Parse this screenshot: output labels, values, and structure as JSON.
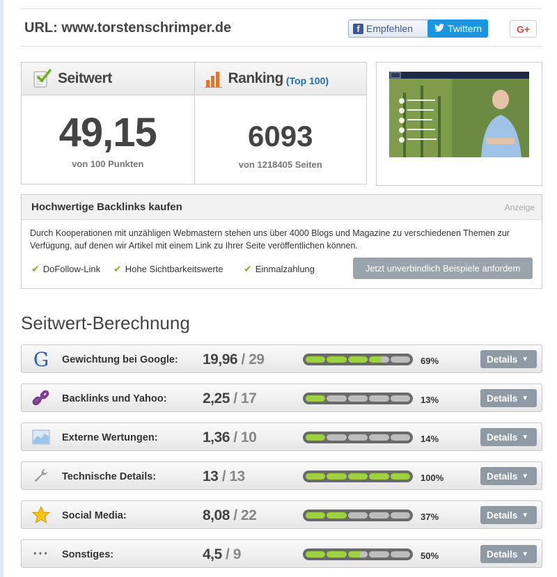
{
  "header": {
    "url_label": "URL: www.torstenschrimper.de",
    "facebook_label": "Empfehlen",
    "twitter_label": "Twittern",
    "gplus_label": "G+"
  },
  "scores": {
    "seitwert": {
      "title": "Seitwert",
      "value": "49,15",
      "caption": "von 100 Punkten"
    },
    "ranking": {
      "title": "Ranking",
      "subtitle": "(Top 100)",
      "value": "6093",
      "caption": "von 1218405 Seiten"
    }
  },
  "ad": {
    "title": "Hochwertige Backlinks kaufen",
    "tag": "Anzeige",
    "text": "Durch Kooperationen mit unzähligen Webmastern stehen uns über 4000 Blogs und Magazine zu verschiedenen Themen zur Verfügung, auf denen wir Artikel mit einem Link zu Ihrer Seite veröffentlichen können.",
    "features": [
      "DoFollow-Link",
      "Hohe Sichtbarkeitswerte",
      "Einmalzahlung"
    ],
    "button_label": "Jetzt unverbindlich Beispiele anfordem"
  },
  "section_title": "Seitwert-Berechnung",
  "rows": [
    {
      "icon": "google-icon",
      "label": "Gewichtung bei Google:",
      "score": "19,96",
      "max": "/ 29",
      "percent": 69,
      "percent_label": "69%",
      "details_label": "Details"
    },
    {
      "icon": "link-icon",
      "label": "Backlinks und Yahoo:",
      "score": "2,25",
      "max": "/ 17",
      "percent": 13,
      "percent_label": "13%",
      "details_label": "Details"
    },
    {
      "icon": "chart-icon",
      "label": "Externe Wertungen:",
      "score": "1,36",
      "max": "/ 10",
      "percent": 14,
      "percent_label": "14%",
      "details_label": "Details"
    },
    {
      "icon": "wrench-icon",
      "label": "Technische Details:",
      "score": "13",
      "max": "/ 13",
      "percent": 100,
      "percent_label": "100%",
      "details_label": "Details"
    },
    {
      "icon": "star-icon",
      "label": "Social Media:",
      "score": "8,08",
      "max": "/ 22",
      "percent": 37,
      "percent_label": "37%",
      "details_label": "Details"
    },
    {
      "icon": "ellipsis-icon",
      "label": "Sonstiges:",
      "score": "4,5",
      "max": "/ 9",
      "percent": 50,
      "percent_label": "50%",
      "details_label": "Details"
    }
  ],
  "colors": {
    "bar_fill": "#9ed13f",
    "button": "#8e9aa6",
    "accent_blue": "#1f6db3"
  }
}
